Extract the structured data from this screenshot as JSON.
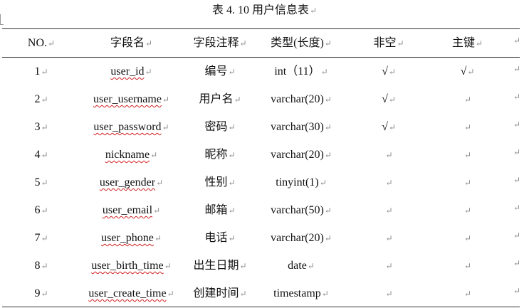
{
  "caption": "表 4. 10 用户信息表",
  "paragraph_mark": "↵",
  "headers": [
    "NO.",
    "字段名",
    "字段注释",
    "类型(长度)",
    "非空",
    "主键"
  ],
  "rows": [
    {
      "no": "1",
      "field": "user_id",
      "comment": "编号",
      "type": "int（11）",
      "not_null": "√",
      "primary_key": "√"
    },
    {
      "no": "2",
      "field": "user_username",
      "comment": "用户名",
      "type": "varchar(20)",
      "not_null": "√",
      "primary_key": ""
    },
    {
      "no": "3",
      "field": "user_password",
      "comment": "密码",
      "type": "varchar(30)",
      "not_null": "√",
      "primary_key": ""
    },
    {
      "no": "4",
      "field": "nickname",
      "comment": "昵称",
      "type": "varchar(20)",
      "not_null": "",
      "primary_key": ""
    },
    {
      "no": "5",
      "field": "user_gender",
      "comment": "性别",
      "type": "tinyint(1)",
      "not_null": "",
      "primary_key": ""
    },
    {
      "no": "6",
      "field": "user_email",
      "comment": "邮箱",
      "type": "varchar(50)",
      "not_null": "",
      "primary_key": ""
    },
    {
      "no": "7",
      "field": "user_phone",
      "comment": "电话",
      "type": "varchar(20)",
      "not_null": "",
      "primary_key": ""
    },
    {
      "no": "8",
      "field": "user_birth_time",
      "comment": "出生日期",
      "type": "date",
      "not_null": "",
      "primary_key": ""
    },
    {
      "no": "9",
      "field": "user_create_time",
      "comment": "创建时间",
      "type": "timestamp",
      "not_null": "",
      "primary_key": ""
    }
  ]
}
